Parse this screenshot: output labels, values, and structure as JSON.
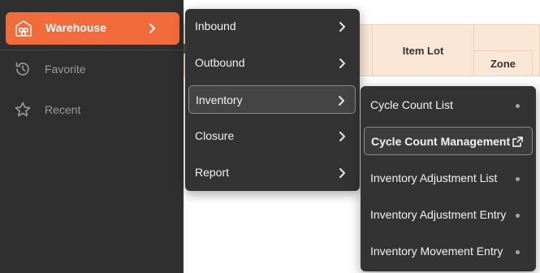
{
  "sidebar": {
    "primary": {
      "label": "Warehouse",
      "icon": "warehouse-icon",
      "color": "#f26b3a"
    },
    "items": [
      {
        "label": "Favorite",
        "icon": "history-icon"
      },
      {
        "label": "Recent",
        "icon": "star-icon"
      }
    ]
  },
  "table": {
    "headers": {
      "item_lot": "Item Lot",
      "zone": "Zone"
    }
  },
  "menu": {
    "items": [
      {
        "label": "Inbound"
      },
      {
        "label": "Outbound"
      },
      {
        "label": "Inventory",
        "active": true
      },
      {
        "label": "Closure"
      },
      {
        "label": "Report"
      }
    ]
  },
  "submenu": {
    "items": [
      {
        "label": "Cycle Count List"
      },
      {
        "label": "Cycle Count Management",
        "active": true,
        "icon": "external-link-icon"
      },
      {
        "label": "Inventory Adjustment List"
      },
      {
        "label": "Inventory Adjustment Entry"
      },
      {
        "label": "Inventory Movement Entry"
      }
    ]
  }
}
